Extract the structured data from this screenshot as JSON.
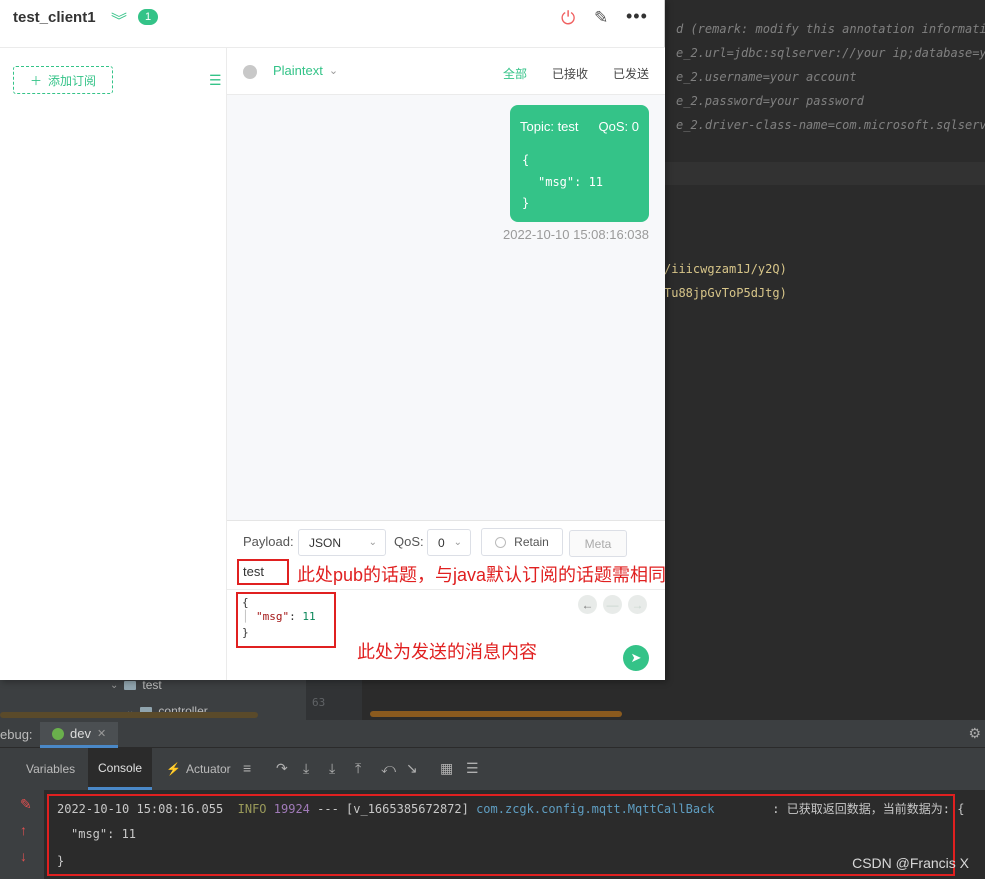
{
  "ide": {
    "code_lines": [
      "d (remark: modify this annotation information)",
      "e_2.url=jdbc:sqlserver://your ip;database=your",
      "e_2.username=your account",
      "e_2.password=your password",
      "e_2.driver-class-name=com.microsoft.sqlserver."
    ],
    "code_lines_yellow": [
      "/iiicwgzam1J/y2Q)",
      "Tu88jpGvToP5dJtg)"
    ],
    "tree_items": [
      "test",
      "controller"
    ],
    "line_number": "63",
    "debug_label": "ebug:",
    "run_tab": "dev",
    "toolbar_tabs": [
      "Variables",
      "Console",
      "Actuator"
    ],
    "console": {
      "line1": {
        "timestamp": "2022-10-10 15:08:16.055",
        "level": "INFO",
        "pid": "19924",
        "thread": "--- [v_1665385672872]",
        "logger": "com.zcgk.config.mqtt.MqttCallBack",
        "message": ": 已获取返回数据，当前数据为: {"
      },
      "line2": "\"msg\": 11",
      "line3": "}"
    },
    "watermark": "CSDN @Francis X"
  },
  "mqttx": {
    "client_name": "test_client1",
    "badge_count": "1",
    "add_subscription": "添加订阅",
    "format": "Plaintext",
    "filters": [
      "全部",
      "已接收",
      "已发送"
    ],
    "message": {
      "topic": "Topic: test",
      "qos": "QoS: 0",
      "body_open": "{",
      "body_key": "\"msg\"",
      "body_value": "11",
      "body_close": "}",
      "time": "2022-10-10 15:08:16:038"
    },
    "compose": {
      "payload_label": "Payload:",
      "payload_type": "JSON",
      "qos_label": "QoS:",
      "qos_value": "0",
      "retain_label": "Retain",
      "meta_label": "Meta",
      "topic_value": "test",
      "payload_open": "{",
      "payload_key": "\"msg\"",
      "payload_value": "11",
      "payload_close": "}"
    }
  },
  "annotations": {
    "topic_note": "此处pub的话题，与java默认订阅的话题需相同",
    "payload_note": "此处为发送的消息内容"
  },
  "colors": {
    "accent": "#34c388",
    "annotation_red": "#e02020",
    "ide_bg": "#2b2b2b"
  }
}
